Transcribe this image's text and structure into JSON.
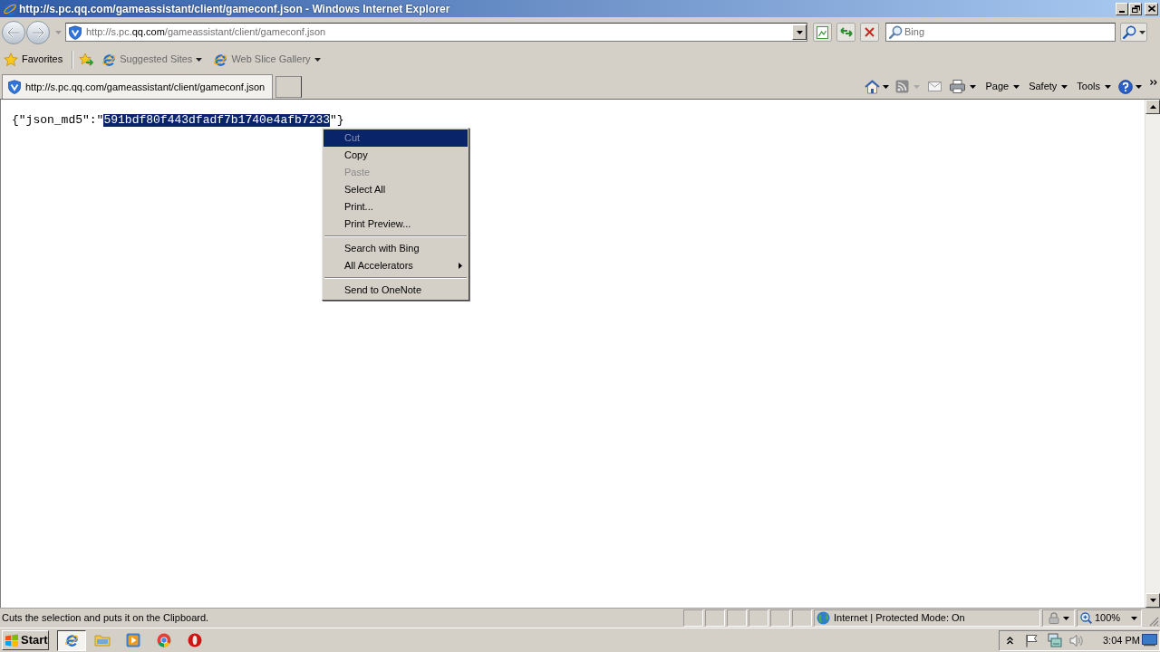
{
  "window": {
    "title": "http://s.pc.qq.com/gameassistant/client/gameconf.json - Windows Internet Explorer"
  },
  "address_bar": {
    "url": "http://s.pc.**qq.com**/gameassistant/client/gameconf.json"
  },
  "search": {
    "placeholder": "Bing"
  },
  "favorites_bar": {
    "label": "Favorites",
    "links": [
      {
        "label": "Suggested Sites"
      },
      {
        "label": "Web Slice Gallery"
      }
    ]
  },
  "tabs": [
    {
      "label": "http://s.pc.qq.com/gameassistant/client/gameconf.json",
      "selected": true
    }
  ],
  "command_bar": {
    "menus": [
      {
        "label": "Page"
      },
      {
        "label": "Safety"
      },
      {
        "label": "Tools"
      }
    ]
  },
  "document": {
    "text_before": "{\"json_md5\":\"",
    "selection": "591bdf80f443dfadf7b1740e4afb7233",
    "text_after": "\"}"
  },
  "context_menu": {
    "items": [
      {
        "kind": "item",
        "label": "Cut",
        "disabled": true,
        "selected": true,
        "submenu": false
      },
      {
        "kind": "item",
        "label": "Copy",
        "disabled": false,
        "selected": false,
        "submenu": false
      },
      {
        "kind": "item",
        "label": "Paste",
        "disabled": true,
        "selected": false,
        "submenu": false
      },
      {
        "kind": "item",
        "label": "Select All",
        "disabled": false,
        "selected": false,
        "submenu": false
      },
      {
        "kind": "item",
        "label": "Print...",
        "disabled": false,
        "selected": false,
        "submenu": false
      },
      {
        "kind": "item",
        "label": "Print Preview...",
        "disabled": false,
        "selected": false,
        "submenu": false
      },
      {
        "kind": "separator"
      },
      {
        "kind": "item",
        "label": "Search with Bing",
        "disabled": false,
        "selected": false,
        "submenu": false
      },
      {
        "kind": "item",
        "label": "All Accelerators",
        "disabled": false,
        "selected": false,
        "submenu": true
      },
      {
        "kind": "separator"
      },
      {
        "kind": "item",
        "label": "Send to OneNote",
        "disabled": false,
        "selected": false,
        "submenu": false
      }
    ]
  },
  "status_bar": {
    "text": "Cuts the selection and puts it on the Clipboard.",
    "zone": "Internet | Protected Mode: On",
    "zoom": "100%"
  },
  "taskbar": {
    "start": "Start",
    "apps": [
      {
        "selected": true
      },
      {
        "selected": false
      },
      {
        "selected": false
      },
      {
        "selected": false
      },
      {
        "selected": false
      }
    ],
    "clock": "3:04 PM"
  }
}
